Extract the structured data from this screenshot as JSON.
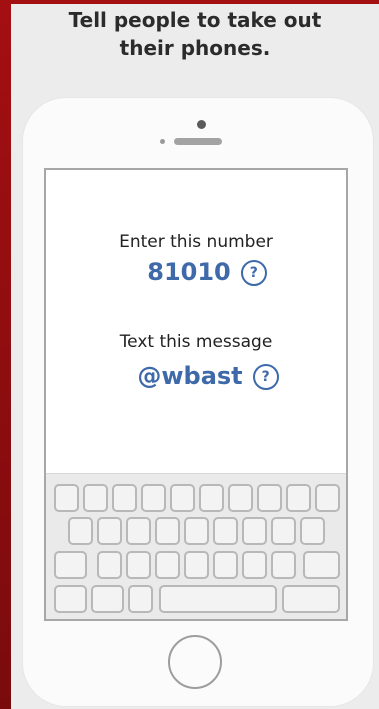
{
  "header": {
    "line1": "Tell people to take out",
    "line2": "their phones."
  },
  "screen": {
    "number_label": "Enter this number",
    "number_value": "81010",
    "message_label": "Text this message",
    "message_value": "@wbast",
    "help_glyph": "?"
  },
  "colors": {
    "accent_blue": "#3e6aaa",
    "brand_red": "#a40f12"
  },
  "icons": {
    "help": "question-circle-icon",
    "home": "home-button-icon"
  }
}
